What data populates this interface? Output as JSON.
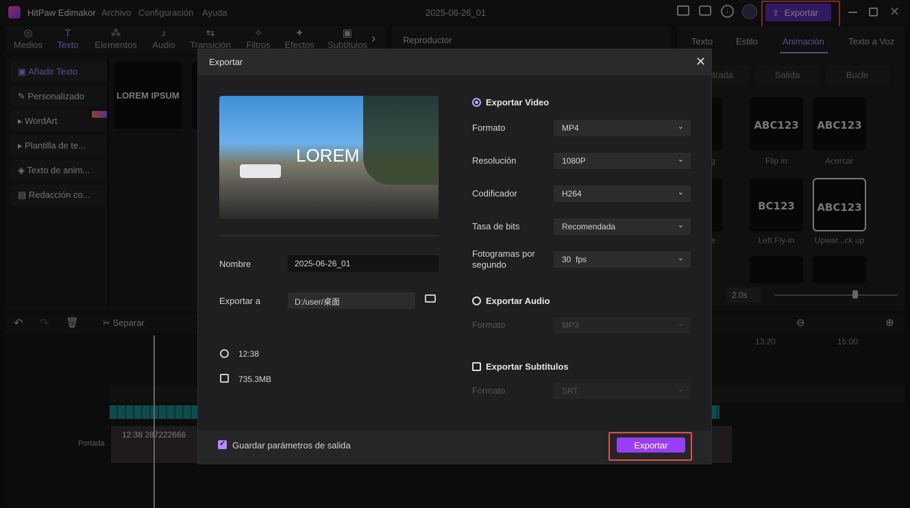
{
  "app": {
    "name": "HitPaw Edimakor",
    "menu": [
      "Archivo",
      "Configuración",
      "Ayuda"
    ],
    "project_title": "2025-06-26_01",
    "export_button": "Exportar"
  },
  "toolbar": {
    "tools": [
      {
        "label": "Medios",
        "icon": "media-icon"
      },
      {
        "label": "Texto",
        "icon": "text-icon",
        "active": true
      },
      {
        "label": "Elementos",
        "icon": "elements-icon"
      },
      {
        "label": "Audio",
        "icon": "audio-icon"
      },
      {
        "label": "Transición",
        "icon": "transition-icon"
      },
      {
        "label": "Filtros",
        "icon": "filters-icon"
      },
      {
        "label": "Efectos",
        "icon": "effects-icon"
      },
      {
        "label": "Subtítulos",
        "icon": "subtitles-icon"
      }
    ]
  },
  "left_panel": {
    "items": [
      "Añadir Texto",
      "Personalizado",
      "WordArt",
      "Plantilla de te...",
      "Texto de anim...",
      "Redacción co..."
    ]
  },
  "content": {
    "tile_text": "LOREM IPSUM"
  },
  "player": {
    "title": "Reproductor"
  },
  "right_panel": {
    "tabs": [
      "Texto",
      "Estilo",
      "Animación",
      "Texto a Voz"
    ],
    "subtabs": [
      "Entrada",
      "Salida",
      "Bucle"
    ],
    "cards": [
      {
        "text": "ABC123",
        "label": "Flip in"
      },
      {
        "text": "ABC123",
        "label": "Acercar"
      },
      {
        "text": "BC123",
        "label": "Left Fly-in"
      },
      {
        "text": "ABC123",
        "label": "Upwar...ck up"
      }
    ],
    "partial_labels": [
      "...ating",
      "...unce"
    ],
    "duration": "2.0s"
  },
  "timeline": {
    "separar": "Separar",
    "ticks": [
      "13:20",
      "15:00"
    ],
    "clip_label": "12:38  287222666",
    "cover_label": "Portada"
  },
  "dialog": {
    "title": "Exportar",
    "preview_text": "LOREM",
    "name_label": "Nombre",
    "name_value": "2025-06-26_01",
    "export_to_label": "Exportar a",
    "export_to_value": "D:/user/桌面",
    "duration": "12:38",
    "size": "735.3MB",
    "video_section": "Exportar Video",
    "audio_section": "Exportar Audio",
    "subtitle_section": "Exportar Subtítulos",
    "fields": [
      {
        "label": "Formato",
        "value": "MP4"
      },
      {
        "label": "Resolución",
        "value": "1080P"
      },
      {
        "label": "Codificador",
        "value": "H264"
      },
      {
        "label": "Tasa de bits",
        "value": "Recomendada"
      },
      {
        "label": "Fotogramas por segundo",
        "value": "30  fps"
      }
    ],
    "audio_format_label": "Formato",
    "audio_format_value": "MP3",
    "subtitle_format_label": "Formato",
    "subtitle_format_value": "SRT",
    "save_params_label": "Guardar parámetros de salida",
    "export_button": "Exportar"
  },
  "colors": {
    "accent": "#a78bfa",
    "button": "#9b3df5",
    "highlight": "#e2514a"
  }
}
